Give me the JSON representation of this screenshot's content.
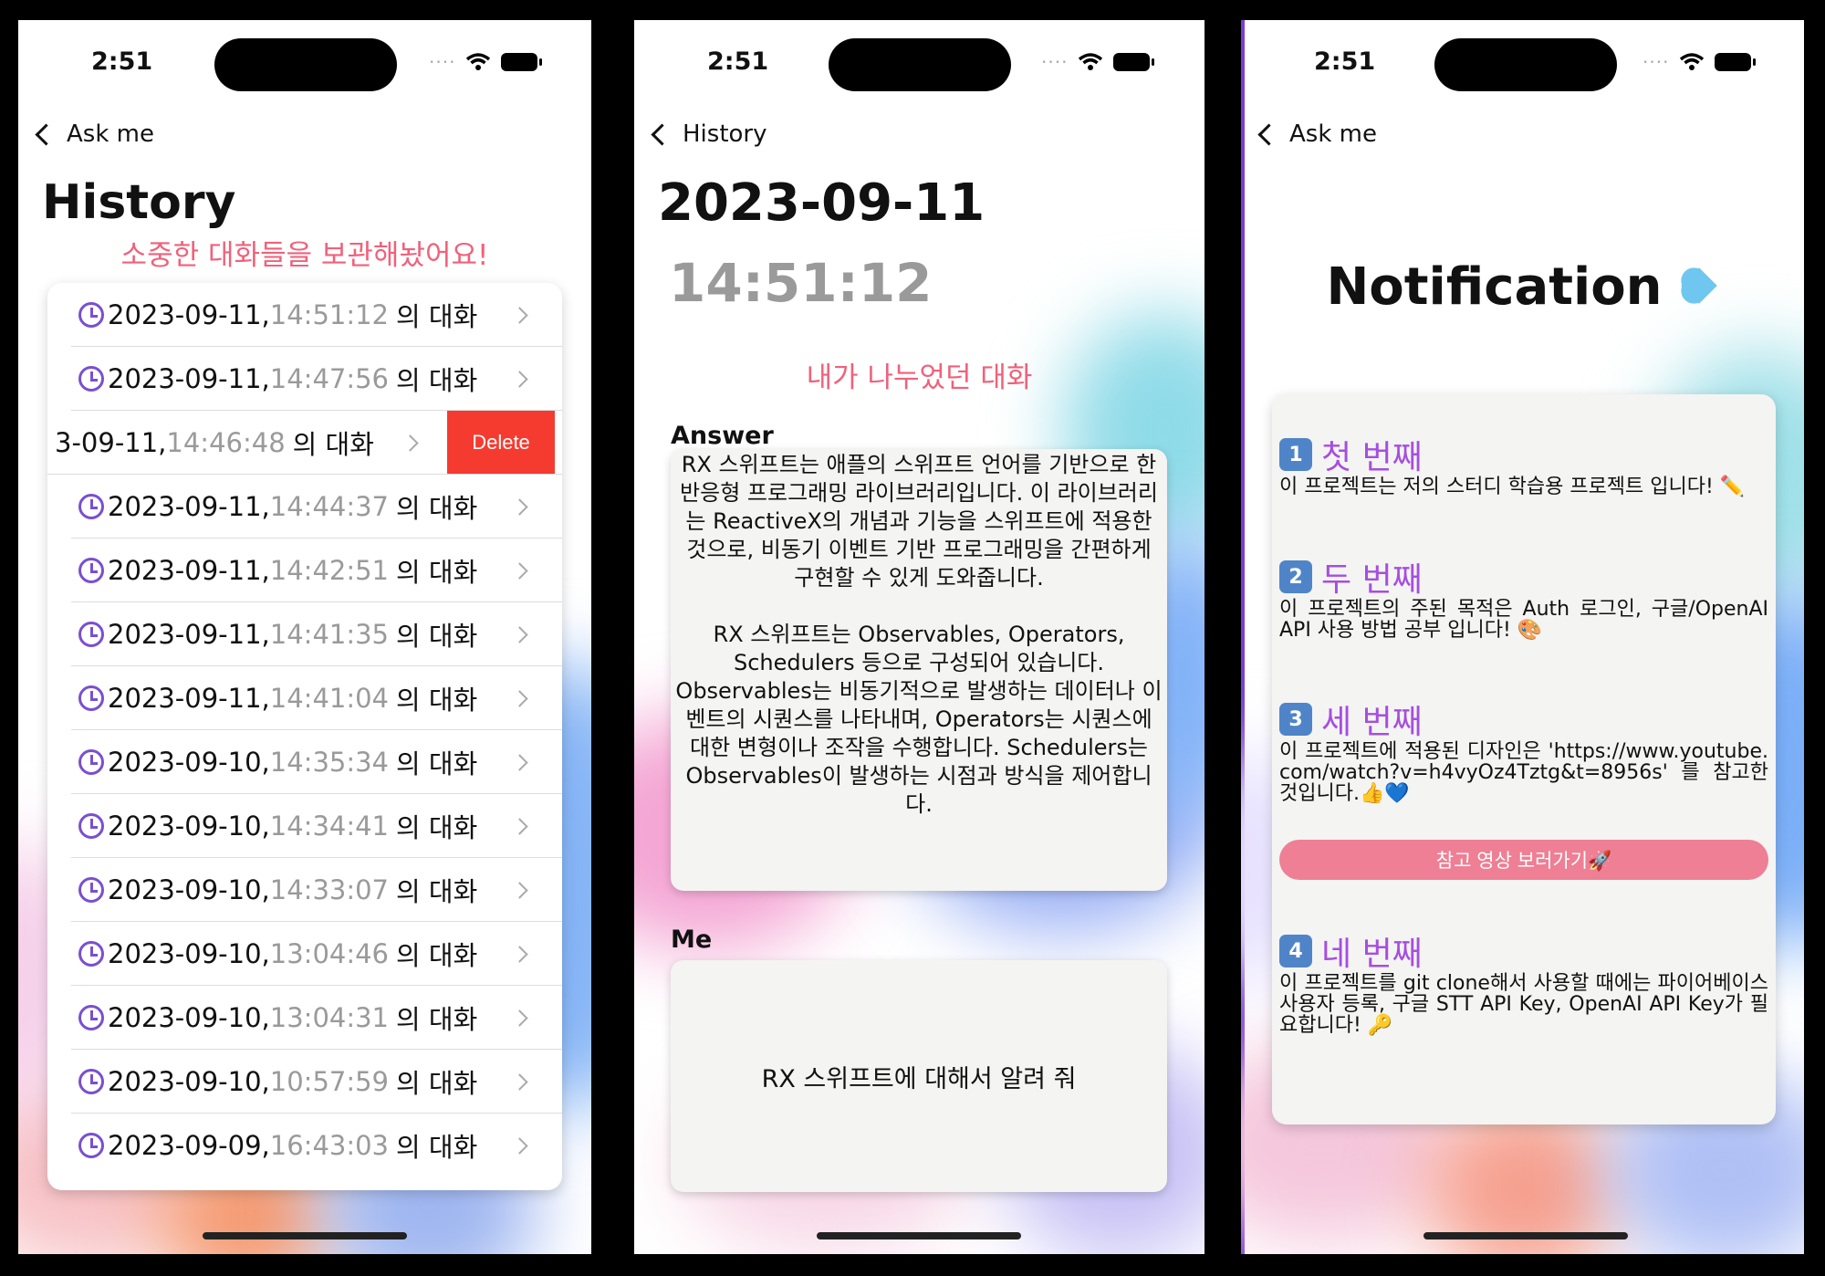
{
  "status": {
    "time": "2:51",
    "signal": "····"
  },
  "history_screen": {
    "back_label": "Ask me",
    "title": "History",
    "subtitle": "소중한 대화들을 보관해놨어요!",
    "suffix": "의 대화",
    "delete_label": "Delete",
    "rows": [
      {
        "date": "2023-09-11,",
        "time": "14:51:12"
      },
      {
        "date": "2023-09-11,",
        "time": "14:47:56"
      },
      {
        "date": "3-09-11,",
        "time": "14:46:48",
        "swiped": true
      },
      {
        "date": "2023-09-11,",
        "time": "14:44:37"
      },
      {
        "date": "2023-09-11,",
        "time": "14:42:51"
      },
      {
        "date": "2023-09-11,",
        "time": "14:41:35"
      },
      {
        "date": "2023-09-11,",
        "time": "14:41:04"
      },
      {
        "date": "2023-09-10,",
        "time": "14:35:34"
      },
      {
        "date": "2023-09-10,",
        "time": "14:34:41"
      },
      {
        "date": "2023-09-10,",
        "time": "14:33:07"
      },
      {
        "date": "2023-09-10,",
        "time": "13:04:46"
      },
      {
        "date": "2023-09-10,",
        "time": "13:04:31"
      },
      {
        "date": "2023-09-10,",
        "time": "10:57:59"
      },
      {
        "date": "2023-09-09,",
        "time": "16:43:03"
      }
    ]
  },
  "detail_screen": {
    "back_label": "History",
    "date": "2023-09-11",
    "time": "14:51:12",
    "subtitle": "내가 나누었던 대화",
    "answer_label": "Answer",
    "answer_text": "RX 스위프트는 애플의 스위프트 언어를 기반으로 한 반응형 프로그래밍 라이브러리입니다. 이 라이브러리는 ReactiveX의 개념과 기능을 스위프트에 적용한 것으로, 비동기 이벤트 기반 프로그래밍을 간편하게 구현할 수 있게 도와줍니다.\n\nRX 스위프트는 Observables, Operators, Schedulers 등으로 구성되어 있습니다. Observables는 비동기적으로 발생하는 데이터나 이벤트의 시퀀스를 나타내며, Operators는 시퀀스에 대한 변형이나 조작을 수행합니다. Schedulers는 Observables이 발생하는 시점과 방식을 제어합니다.",
    "me_label": "Me",
    "me_text": "RX 스위프트에 대해서 알려 줘"
  },
  "notification_screen": {
    "back_label": "Ask me",
    "title": "Notification",
    "sections": [
      {
        "num": "1",
        "heading": "첫 번째",
        "body": "이 프로젝트는 저의 스터디 학습용 프로젝트 입니다! ✏️"
      },
      {
        "num": "2",
        "heading": "두 번째",
        "body": "이 프로젝트의 주된 목적은 Auth 로그인, 구글/OpenAI API 사용 방법 공부 입니다! 🎨"
      },
      {
        "num": "3",
        "heading": "세 번째",
        "body": "이 프로젝트에 적용된 디자인은 'https://www.youtube.com/watch?v=h4vyOz4Tztg&t=8956s' 를 참고한 것입니다.👍💙"
      },
      {
        "num": "4",
        "heading": "네 번째",
        "body": "이 프로젝트를 git clone해서 사용할 때에는 파이어베이스 사용자 등록, 구글 STT API Key, OpenAI API Key가 필요합니다! 🔑"
      }
    ],
    "video_button_label": "참고 영상 보러가기🚀"
  },
  "colors": {
    "accent_pink": "#f0617a",
    "accent_purple": "#a64ee0",
    "delete_red": "#f53b30",
    "button_pink": "#ee7f94",
    "keycap_blue": "#4f85c8"
  }
}
